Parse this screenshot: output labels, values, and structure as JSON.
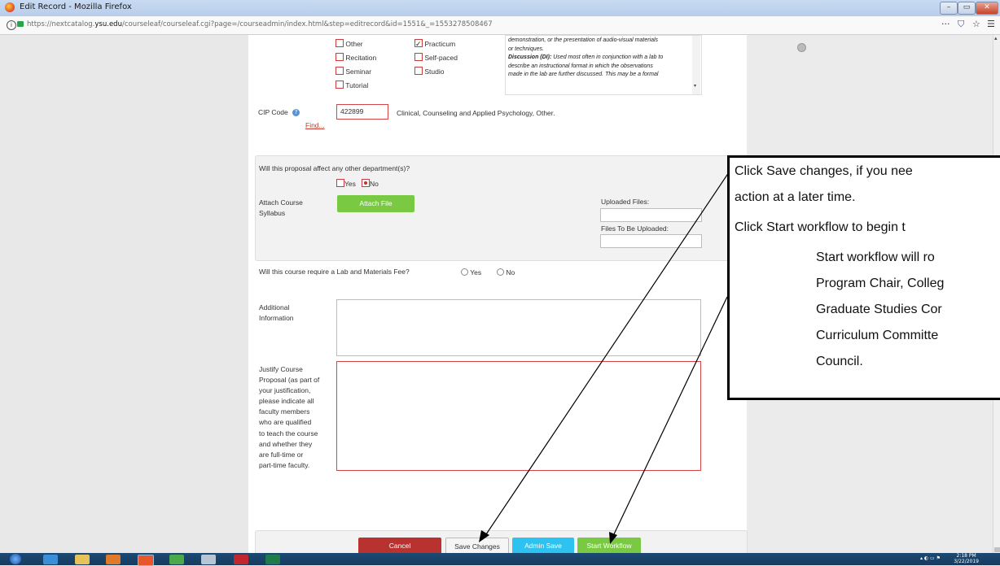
{
  "window": {
    "title": "Edit Record - Mozilla Firefox",
    "url_prefix": "https://nextcatalog.",
    "url_domain": "ysu.edu",
    "url_suffix": "/courseleaf/courseleaf.cgi?page=/courseadmin/index.html&step=editrecord&id=1551&_=1553278508467",
    "controls": [
      "–",
      "▭",
      "✕"
    ],
    "toolbar_icons": [
      "···",
      "⛉",
      "☆",
      "☰"
    ]
  },
  "format_options": {
    "col1": [
      {
        "label": "Other",
        "checked": false
      },
      {
        "label": "Recitation",
        "checked": false
      },
      {
        "label": "Seminar",
        "checked": false
      },
      {
        "label": "Tutorial",
        "checked": false
      }
    ],
    "col2": [
      {
        "label": "Practicum",
        "checked": true
      },
      {
        "label": "Self-paced",
        "checked": false
      },
      {
        "label": "Studio",
        "checked": false
      }
    ]
  },
  "description_box": {
    "line1": "demonstration, or the presentation of audio-visual materials",
    "line2": "or techniques.",
    "line3_bold": "Discussion (DI):",
    "line3": " Used most often in conjunction with a lab to",
    "line4": "describe an instructional format in which the observations",
    "line5": "made in the lab are further discussed. This may be a formal"
  },
  "cip": {
    "label": "CIP Code",
    "find_link": "Find...",
    "value": "422899",
    "description": "Clinical, Counseling and Applied Psychology, Other."
  },
  "affect": {
    "question": "Will this proposal affect any other department(s)?",
    "yes": "Yes",
    "no": "No",
    "selected": "No"
  },
  "attach": {
    "label_line1": "Attach Course",
    "label_line2": "Syllabus",
    "button": "Attach File",
    "uploaded_label": "Uploaded Files:",
    "to_upload_label": "Files To Be Uploaded:"
  },
  "lab_fee": {
    "question": "Will this course require a Lab and Materials Fee?",
    "yes": "Yes",
    "no": "No"
  },
  "additional": {
    "label_line1": "Additional",
    "label_line2": "Information",
    "value": ""
  },
  "justify": {
    "label_lines": [
      "Justify Course",
      "Proposal (as part of",
      "your justification,",
      "please indicate all",
      "faculty members",
      "who are qualified",
      "to teach the course",
      "and whether they",
      "are full-time or",
      "part-time faculty."
    ],
    "value": ""
  },
  "actions": {
    "cancel": "Cancel",
    "save": "Save Changes",
    "admin_save": "Admin Save",
    "start": "Start Workflow"
  },
  "callout": {
    "line1": "Click Save changes, if you nee",
    "line2": "action at a later time.",
    "line3": "Click Start workflow to begin t",
    "line4": "Start workflow will ro",
    "line5": "Program Chair, Colleg",
    "line6": "Graduate Studies Cor",
    "line7": "Curriculum Committe",
    "line8": "Council."
  },
  "taskbar": {
    "time": "2:18 PM",
    "date": "3/22/2019"
  },
  "colors": {
    "cancel": "#b8332f",
    "admin_save": "#2ec2f0",
    "start_workflow": "#7ac943",
    "attach_file": "#7ac943",
    "required_border": "#d64545"
  }
}
